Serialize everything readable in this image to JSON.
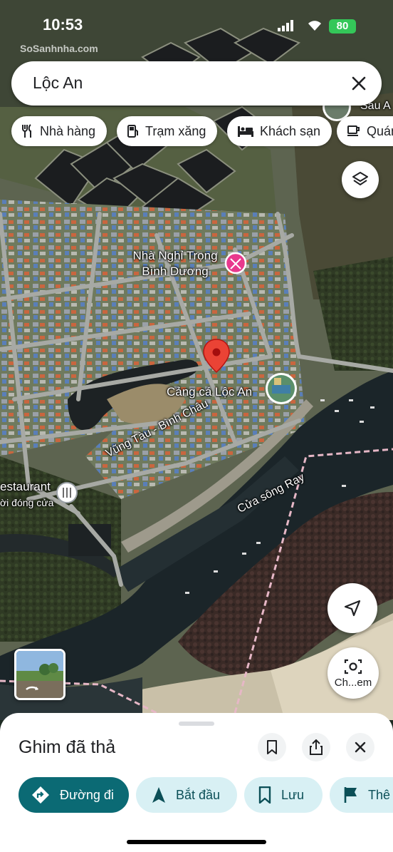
{
  "status_bar": {
    "time": "10:53",
    "battery": "80"
  },
  "watermark": "SoSanhnha.com",
  "search": {
    "query": "Lộc An",
    "close_icon": "close-icon"
  },
  "chips": [
    {
      "label": "Nhà hàng",
      "icon": "restaurant-icon"
    },
    {
      "label": "Trạm xăng",
      "icon": "gas-station-icon"
    },
    {
      "label": "Khách sạn",
      "icon": "hotel-icon"
    },
    {
      "label": "Quán",
      "icon": "coffee-icon"
    }
  ],
  "map": {
    "corner_label": "Sau A",
    "poi_guesthouse": "Nhà Nghỉ Trọng\nBình Dương",
    "poi_port": "Cảng cá Lộc An",
    "road": "Vũng Tàu - Bình Châu",
    "river": "Cửa sông Ray",
    "restaurant_name": "estaurant",
    "restaurant_status": "ời đóng cửa",
    "pin_color": "#ea4335",
    "poi_color": "#e8398d"
  },
  "lens": {
    "label": "Ch...em"
  },
  "sheet": {
    "title": "Ghim đã thả",
    "actions": {
      "directions": "Đường đi",
      "start": "Bắt đầu",
      "save": "Lưu",
      "label": "Thê"
    },
    "accent": "#0b6a74"
  }
}
